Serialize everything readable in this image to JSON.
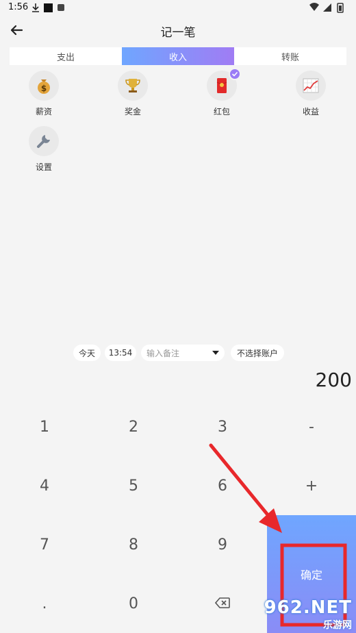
{
  "status_bar": {
    "time": "1:56"
  },
  "header": {
    "title": "记一笔"
  },
  "tabs": [
    {
      "label": "支出",
      "active": false
    },
    {
      "label": "收入",
      "active": true
    },
    {
      "label": "转账",
      "active": false
    }
  ],
  "categories": [
    {
      "label": "薪资",
      "icon": "money-bag-icon",
      "selected": false
    },
    {
      "label": "奖金",
      "icon": "trophy-icon",
      "selected": false
    },
    {
      "label": "红包",
      "icon": "red-envelope-icon",
      "selected": true
    },
    {
      "label": "收益",
      "icon": "chart-icon",
      "selected": false
    },
    {
      "label": "设置",
      "icon": "wrench-icon",
      "selected": false
    }
  ],
  "entry": {
    "date_label": "今天",
    "time": "13:54",
    "note_placeholder": "输入备注",
    "account_label": "不选择账户",
    "amount": "200"
  },
  "keypad": {
    "keys": [
      "1",
      "2",
      "3",
      "-",
      "4",
      "5",
      "6",
      "+",
      "7",
      "8",
      "9",
      ".",
      "0"
    ],
    "confirm_label": "确定"
  },
  "watermark": {
    "main": "962.NET",
    "sub": "乐游网"
  },
  "colors": {
    "accent_start": "#6fa6ff",
    "accent_end": "#a07cf4",
    "annotation_red": "#e8282b"
  }
}
